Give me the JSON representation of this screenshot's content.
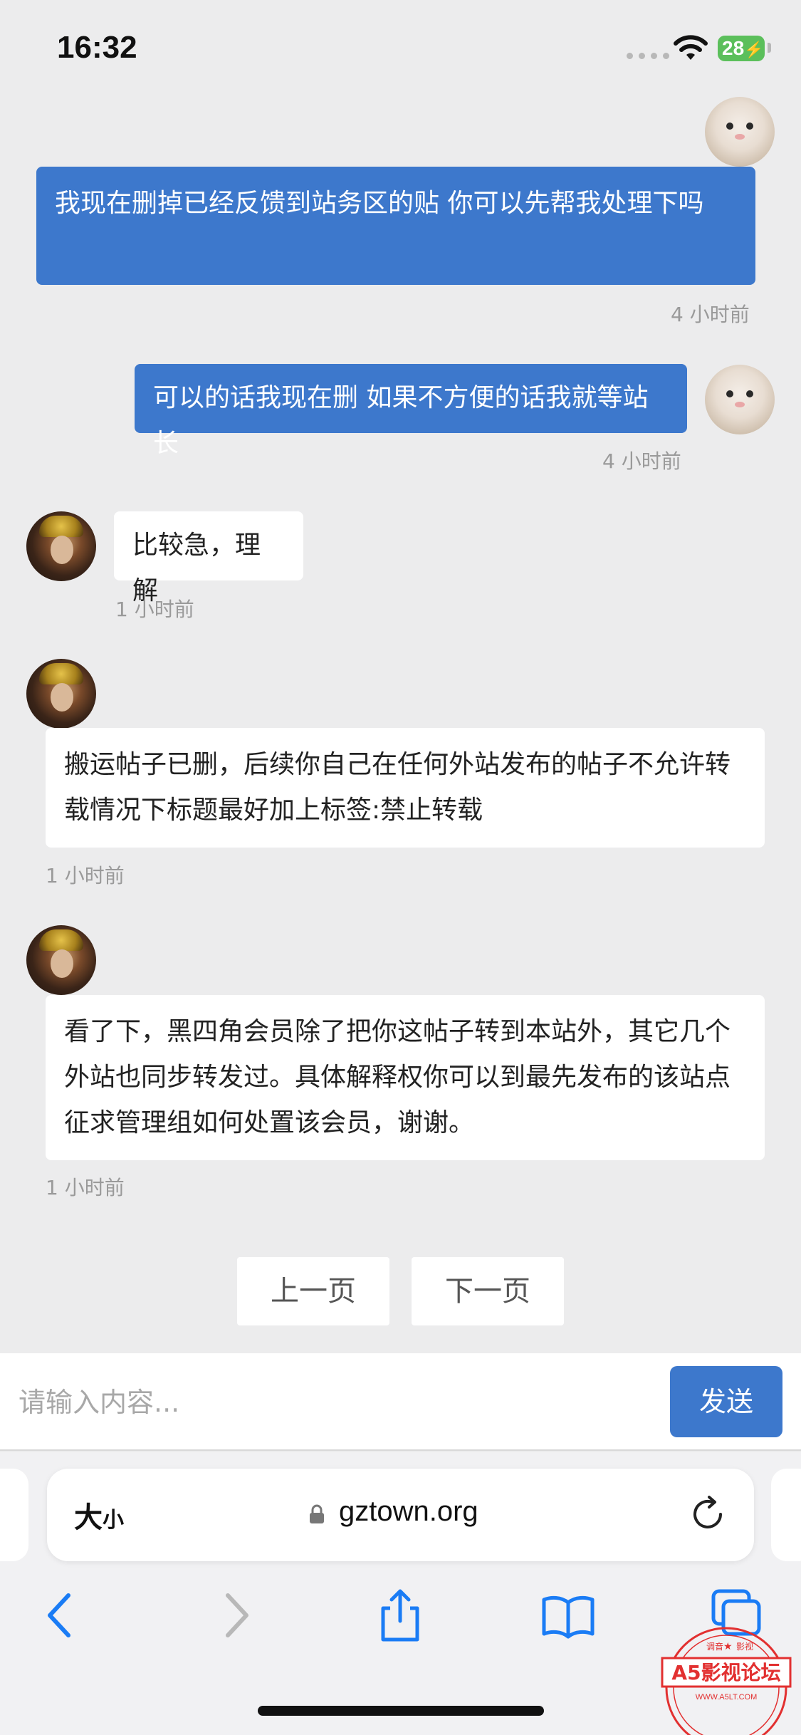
{
  "status_bar": {
    "time": "16:32",
    "battery": "28"
  },
  "messages": [
    {
      "side": "right",
      "text": "我现在删掉已经反馈到站务区的贴  你可以先帮我处理下吗",
      "time": "4 小时前"
    },
    {
      "side": "right",
      "text": "可以的话我现在删 如果不方便的话我就等站长",
      "time": "4 小时前"
    },
    {
      "side": "left",
      "text": "比较急，理解",
      "time": "1 小时前"
    },
    {
      "side": "left",
      "text": "搬运帖子已删，后续你自己在任何外站发布的帖子不允许转载情况下标题最好加上标签:禁止转载",
      "time": "1 小时前"
    },
    {
      "side": "left",
      "text": "看了下，黑四角会员除了把你这帖子转到本站外，其它几个外站也同步转发过。具体解释权你可以到最先发布的该站点征求管理组如何处置该会员，谢谢。",
      "time": "1 小时前"
    }
  ],
  "pagination": {
    "prev": "上一页",
    "next": "下一页"
  },
  "composer": {
    "placeholder": "请输入内容...",
    "send": "发送"
  },
  "browser": {
    "text_size_big": "大",
    "text_size_small": "小",
    "url": "gztown.org"
  },
  "watermark": {
    "brand": "A5影视论坛",
    "site": "WWW.A5LT.COM",
    "top_left": "调音",
    "top_right": "影视"
  },
  "colors": {
    "accent": "#3d78cc",
    "background": "#ececed",
    "ios_blue": "#1a7cf5"
  }
}
